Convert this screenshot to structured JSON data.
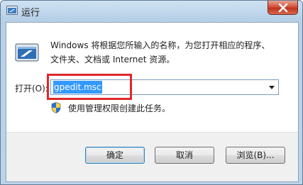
{
  "window": {
    "title": "运行"
  },
  "description": {
    "line1": "Windows 将根据您所输入的名称，为您打开相应的程序、",
    "line2": "文件夹、文档或 Internet 资源。"
  },
  "open_field": {
    "label": "打开(O):",
    "value": "gpedit.msc"
  },
  "admin_note": "使用管理权限创建此任务。",
  "buttons": {
    "ok": "确定",
    "cancel": "取消",
    "browse": "浏览(B)..."
  },
  "colors": {
    "selection": "#3399ff",
    "highlight_box": "#e0262b",
    "close_button": "#c7432b"
  },
  "icons": {
    "title": "run-icon",
    "close": "close-icon",
    "main": "run-icon",
    "shield": "uac-shield-icon",
    "dropdown": "chevron-down-icon"
  }
}
